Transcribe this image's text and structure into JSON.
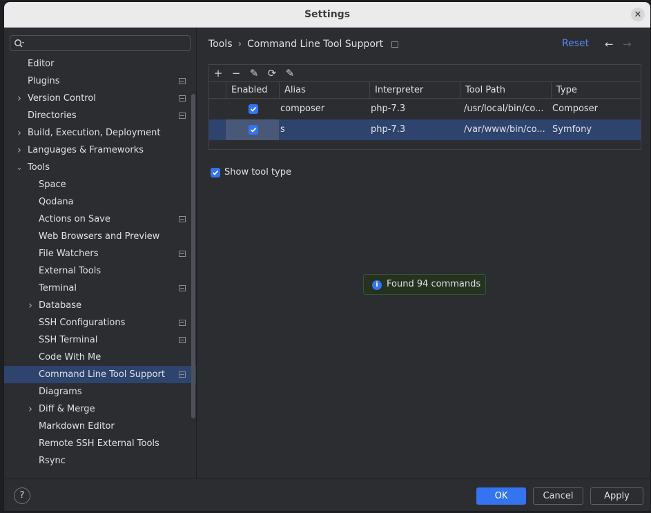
{
  "window": {
    "title": "Settings"
  },
  "search": {
    "placeholder": ""
  },
  "tree": [
    {
      "label": "Editor",
      "level": 0,
      "arrow": false,
      "proj": false
    },
    {
      "label": "Plugins",
      "level": 0,
      "arrow": false,
      "proj": true
    },
    {
      "label": "Version Control",
      "level": 0,
      "arrow": "right",
      "proj": true
    },
    {
      "label": "Directories",
      "level": 0,
      "arrow": false,
      "proj": true
    },
    {
      "label": "Build, Execution, Deployment",
      "level": 0,
      "arrow": "right",
      "proj": false
    },
    {
      "label": "Languages & Frameworks",
      "level": 0,
      "arrow": "right",
      "proj": false
    },
    {
      "label": "Tools",
      "level": 0,
      "arrow": "down",
      "proj": false
    },
    {
      "label": "Space",
      "level": 1,
      "arrow": false,
      "proj": false
    },
    {
      "label": "Qodana",
      "level": 1,
      "arrow": false,
      "proj": false
    },
    {
      "label": "Actions on Save",
      "level": 1,
      "arrow": false,
      "proj": true
    },
    {
      "label": "Web Browsers and Preview",
      "level": 1,
      "arrow": false,
      "proj": false
    },
    {
      "label": "File Watchers",
      "level": 1,
      "arrow": false,
      "proj": true
    },
    {
      "label": "External Tools",
      "level": 1,
      "arrow": false,
      "proj": false
    },
    {
      "label": "Terminal",
      "level": 1,
      "arrow": false,
      "proj": true
    },
    {
      "label": "Database",
      "level": 1,
      "arrow": "right",
      "proj": false
    },
    {
      "label": "SSH Configurations",
      "level": 1,
      "arrow": false,
      "proj": true
    },
    {
      "label": "SSH Terminal",
      "level": 1,
      "arrow": false,
      "proj": true
    },
    {
      "label": "Code With Me",
      "level": 1,
      "arrow": false,
      "proj": false
    },
    {
      "label": "Command Line Tool Support",
      "level": 1,
      "arrow": false,
      "proj": true,
      "selected": true
    },
    {
      "label": "Diagrams",
      "level": 1,
      "arrow": false,
      "proj": false
    },
    {
      "label": "Diff & Merge",
      "level": 1,
      "arrow": "right",
      "proj": false
    },
    {
      "label": "Markdown Editor",
      "level": 1,
      "arrow": false,
      "proj": false
    },
    {
      "label": "Remote SSH External Tools",
      "level": 1,
      "arrow": false,
      "proj": false
    },
    {
      "label": "Rsync",
      "level": 1,
      "arrow": false,
      "proj": false
    }
  ],
  "breadcrumb": {
    "parent": "Tools",
    "current": "Command Line Tool Support"
  },
  "header": {
    "reset": "Reset",
    "back": "←",
    "forward": "→"
  },
  "toolbar": {
    "add": "+",
    "remove": "−",
    "edit": "✎",
    "refresh": "⟳",
    "edit2": "✎"
  },
  "table": {
    "columns": [
      "Enabled",
      "Alias",
      "Interpreter",
      "Tool Path",
      "Type"
    ],
    "rows": [
      {
        "enabled": true,
        "alias": "composer",
        "interpreter": "php-7.3",
        "tool_path": "/usr/local/bin/co...",
        "type": "Composer"
      },
      {
        "enabled": true,
        "alias": "s",
        "interpreter": "php-7.3",
        "tool_path": "/var/www/bin/co...",
        "type": "Symfony"
      }
    ]
  },
  "show_tool_type": {
    "label": "Show tool type",
    "checked": true
  },
  "toast": {
    "message": "Found 94 commands"
  },
  "footer": {
    "help": "?",
    "ok": "OK",
    "cancel": "Cancel",
    "apply": "Apply"
  },
  "colors": {
    "accent": "#3574f0",
    "selection": "#2e436e",
    "link": "#548af7"
  }
}
